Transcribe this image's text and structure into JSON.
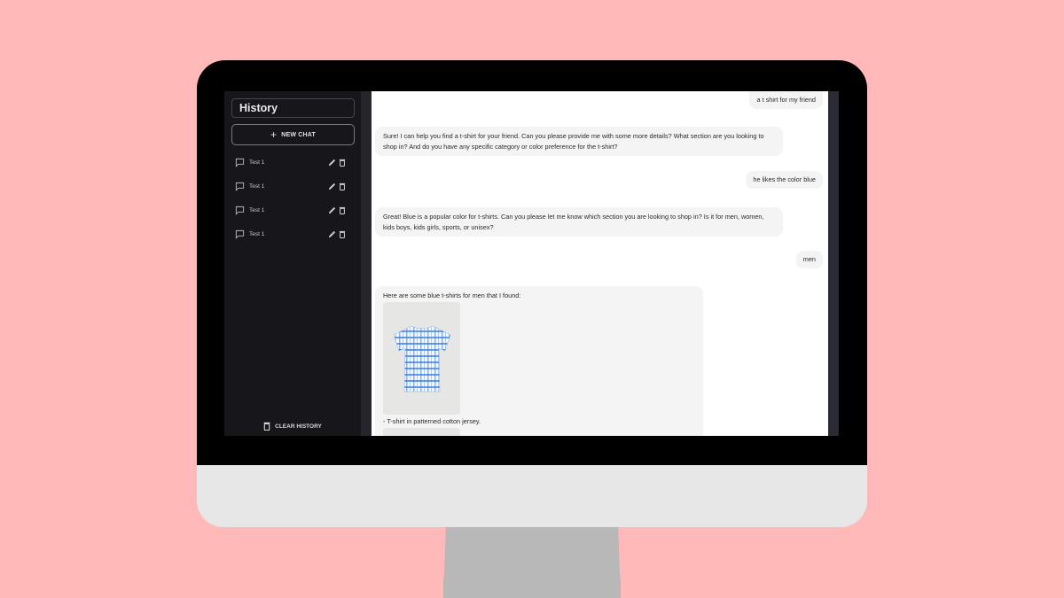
{
  "sidebar": {
    "title": "History",
    "new_chat_label": "NEW CHAT",
    "items": [
      {
        "label": "Test 1"
      },
      {
        "label": "Test 1"
      },
      {
        "label": "Test 1"
      },
      {
        "label": "Test 1"
      }
    ],
    "clear_history_label": "CLEAR HISTORY"
  },
  "chat": {
    "messages": [
      {
        "role": "user",
        "text": "a t shirt for my friend"
      },
      {
        "role": "assistant",
        "text": "Sure! I can help you find a t-shirt for your friend. Can you please provide me with some more details? What section are you looking to shop in? And do you have any specific category or color preference for the t-shirt?"
      },
      {
        "role": "user",
        "text": "he likes the color blue"
      },
      {
        "role": "assistant",
        "text": "Great! Blue is a popular color for t-shirts. Can you please let me know which section you are looking to shop in? Is it for men, women, kids boys, kids girls, sports, or unisex?"
      },
      {
        "role": "user",
        "text": "men"
      },
      {
        "role": "assistant",
        "text": "Here are some blue t-shirts for men that I found:",
        "products": [
          {
            "description": "- T-shirt in patterned cotton jersey."
          }
        ]
      }
    ]
  },
  "colors": {
    "background": "#FFB9B9",
    "sidebar": "#17171B",
    "bubble": "#F4F4F4",
    "product_blue": "#2F6FD0"
  }
}
